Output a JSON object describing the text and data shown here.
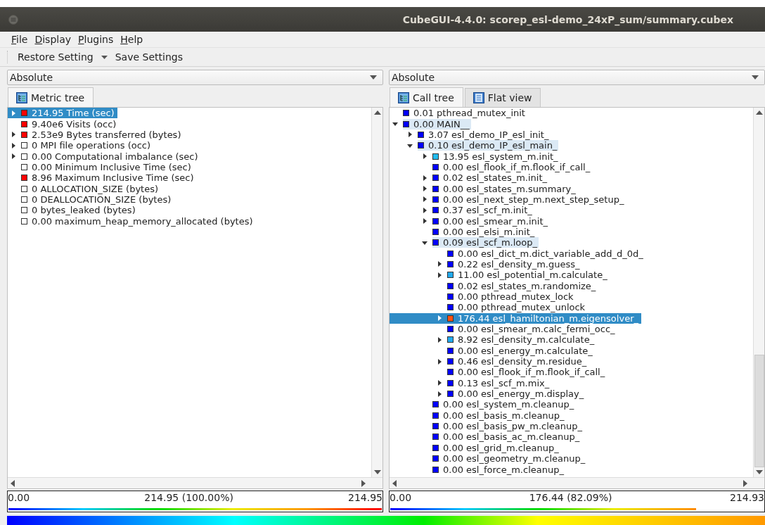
{
  "window": {
    "title": "CubeGUI-4.4.0: scorep_esl-demo_24xP_sum/summary.cubex"
  },
  "menu": [
    {
      "label": "File"
    },
    {
      "label": "Display"
    },
    {
      "label": "Plugins"
    },
    {
      "label": "Help"
    }
  ],
  "toolbar": {
    "restore": "Restore Setting",
    "save": "Save Settings"
  },
  "panes": [
    {
      "mode": "Absolute",
      "tabs": [
        {
          "label": "Metric tree",
          "kind": "tree",
          "selected": true
        }
      ],
      "tree": [
        {
          "label": "214.95 Time (sec)",
          "expandable": true,
          "expanded": false,
          "color": "#ff0000",
          "selected": true,
          "highlighted": false
        },
        {
          "label": "9.40e6 Visits (occ)",
          "expandable": false,
          "expanded": false,
          "color": "#ff0000",
          "selected": false,
          "highlighted": false
        },
        {
          "label": "2.53e9 Bytes transferred (bytes)",
          "expandable": true,
          "expanded": false,
          "color": "#ff0000",
          "selected": false,
          "highlighted": false
        },
        {
          "label": "0 MPI file operations (occ)",
          "expandable": true,
          "expanded": false,
          "color": "#ffffff",
          "selected": false,
          "highlighted": false
        },
        {
          "label": "0.00 Computational imbalance (sec)",
          "expandable": true,
          "expanded": false,
          "color": "#ffffff",
          "selected": false,
          "highlighted": false
        },
        {
          "label": "0.00 Minimum Inclusive Time (sec)",
          "expandable": false,
          "expanded": false,
          "color": "#ffffff",
          "selected": false,
          "highlighted": false
        },
        {
          "label": "8.96 Maximum Inclusive Time (sec)",
          "expandable": false,
          "expanded": false,
          "color": "#ff0000",
          "selected": false,
          "highlighted": false
        },
        {
          "label": "0 ALLOCATION_SIZE (bytes)",
          "expandable": false,
          "expanded": false,
          "color": "#ffffff",
          "selected": false,
          "highlighted": false
        },
        {
          "label": "0 DEALLOCATION_SIZE (bytes)",
          "expandable": false,
          "expanded": false,
          "color": "#ffffff",
          "selected": false,
          "highlighted": false
        },
        {
          "label": "0 bytes_leaked (bytes)",
          "expandable": false,
          "expanded": false,
          "color": "#ffffff",
          "selected": false,
          "highlighted": false
        },
        {
          "label": "0.00 maximum_heap_memory_allocated (bytes)",
          "expandable": false,
          "expanded": false,
          "color": "#ffffff",
          "selected": false,
          "highlighted": false
        }
      ],
      "value_bar": {
        "min": "0.00",
        "value": "214.95 (100.00%)",
        "max": "214.95",
        "level": 1
      }
    },
    {
      "mode": "Absolute",
      "tabs": [
        {
          "label": "Call tree",
          "kind": "tree",
          "selected": true
        },
        {
          "label": "Flat view",
          "kind": "flat",
          "selected": false
        }
      ],
      "tree": [
        {
          "label": "0.01 pthread_mutex_init",
          "expandable": false,
          "expanded": false,
          "color": "#0000ff",
          "selected": false,
          "highlighted": false
        },
        {
          "label": "0.00 MAIN__",
          "expandable": true,
          "expanded": true,
          "color": "#0000ff",
          "selected": false,
          "highlighted": true,
          "children": [
            {
              "label": "3.07 esl_demo_IP_esl_init_",
              "expandable": true,
              "expanded": false,
              "color": "#0000ff",
              "selected": false,
              "highlighted": false
            },
            {
              "label": "0.10 esl_demo_IP_esl_main_",
              "expandable": true,
              "expanded": true,
              "color": "#0000ff",
              "selected": false,
              "highlighted": true,
              "children": [
                {
                  "label": "13.95 esl_system_m.init_",
                  "expandable": true,
                  "expanded": false,
                  "color": "#22bbee",
                  "selected": false,
                  "highlighted": false
                },
                {
                  "label": "0.00 esl_flook_if_m.flook_if_call_",
                  "expandable": false,
                  "expanded": false,
                  "color": "#0000ff",
                  "selected": false,
                  "highlighted": false
                },
                {
                  "label": "0.02 esl_states_m.init_",
                  "expandable": true,
                  "expanded": false,
                  "color": "#0000ff",
                  "selected": false,
                  "highlighted": false
                },
                {
                  "label": "0.00 esl_states_m.summary_",
                  "expandable": true,
                  "expanded": false,
                  "color": "#0000ff",
                  "selected": false,
                  "highlighted": false
                },
                {
                  "label": "0.00 esl_next_step_m.next_step_setup_",
                  "expandable": true,
                  "expanded": false,
                  "color": "#0000ff",
                  "selected": false,
                  "highlighted": false
                },
                {
                  "label": "0.37 esl_scf_m.init_",
                  "expandable": true,
                  "expanded": false,
                  "color": "#0000ff",
                  "selected": false,
                  "highlighted": false
                },
                {
                  "label": "0.00 esl_smear_m.init_",
                  "expandable": true,
                  "expanded": false,
                  "color": "#0000ff",
                  "selected": false,
                  "highlighted": false
                },
                {
                  "label": "0.00 esl_elsi_m.init_",
                  "expandable": false,
                  "expanded": false,
                  "color": "#0000ff",
                  "selected": false,
                  "highlighted": false
                },
                {
                  "label": "0.09 esl_scf_m.loop_",
                  "expandable": true,
                  "expanded": true,
                  "color": "#0000ff",
                  "selected": false,
                  "highlighted": true,
                  "children": [
                    {
                      "label": "0.00 esl_dict_m.dict_variable_add_d_0d_",
                      "expandable": false,
                      "expanded": false,
                      "color": "#0000ff",
                      "selected": false,
                      "highlighted": false
                    },
                    {
                      "label": "0.22 esl_density_m.guess_",
                      "expandable": true,
                      "expanded": false,
                      "color": "#0000ff",
                      "selected": false,
                      "highlighted": false
                    },
                    {
                      "label": "11.00 esl_potential_m.calculate_",
                      "expandable": true,
                      "expanded": false,
                      "color": "#22aaee",
                      "selected": false,
                      "highlighted": false
                    },
                    {
                      "label": "0.02 esl_states_m.randomize_",
                      "expandable": false,
                      "expanded": false,
                      "color": "#0000ff",
                      "selected": false,
                      "highlighted": false
                    },
                    {
                      "label": "0.00 pthread_mutex_lock",
                      "expandable": false,
                      "expanded": false,
                      "color": "#0000ff",
                      "selected": false,
                      "highlighted": false
                    },
                    {
                      "label": "0.00 pthread_mutex_unlock",
                      "expandable": false,
                      "expanded": false,
                      "color": "#0000ff",
                      "selected": false,
                      "highlighted": false
                    },
                    {
                      "label": "176.44 esl_hamiltonian_m.eigensolver_",
                      "expandable": true,
                      "expanded": false,
                      "color": "#ff5010",
                      "selected": true,
                      "highlighted": false
                    },
                    {
                      "label": "0.00 esl_smear_m.calc_fermi_occ_",
                      "expandable": false,
                      "expanded": false,
                      "color": "#0000ff",
                      "selected": false,
                      "highlighted": false
                    },
                    {
                      "label": "8.92 esl_density_m.calculate_",
                      "expandable": true,
                      "expanded": false,
                      "color": "#22aaee",
                      "selected": false,
                      "highlighted": false
                    },
                    {
                      "label": "0.00 esl_energy_m.calculate_",
                      "expandable": false,
                      "expanded": false,
                      "color": "#0000ff",
                      "selected": false,
                      "highlighted": false
                    },
                    {
                      "label": "0.46 esl_density_m.residue_",
                      "expandable": true,
                      "expanded": false,
                      "color": "#0000ff",
                      "selected": false,
                      "highlighted": false
                    },
                    {
                      "label": "0.00 esl_flook_if_m.flook_if_call_",
                      "expandable": false,
                      "expanded": false,
                      "color": "#0000ff",
                      "selected": false,
                      "highlighted": false
                    },
                    {
                      "label": "0.13 esl_scf_m.mix_",
                      "expandable": true,
                      "expanded": false,
                      "color": "#0000ff",
                      "selected": false,
                      "highlighted": false
                    },
                    {
                      "label": "0.00 esl_energy_m.display_",
                      "expandable": true,
                      "expanded": false,
                      "color": "#0000ff",
                      "selected": false,
                      "highlighted": false
                    }
                  ]
                },
                {
                  "label": "0.00 esl_system_m.cleanup_",
                  "expandable": false,
                  "expanded": false,
                  "color": "#0000ff",
                  "selected": false,
                  "highlighted": false
                },
                {
                  "label": "0.00 esl_basis_m.cleanup_",
                  "expandable": false,
                  "expanded": false,
                  "color": "#0000ff",
                  "selected": false,
                  "highlighted": false
                },
                {
                  "label": "0.00 esl_basis_pw_m.cleanup_",
                  "expandable": false,
                  "expanded": false,
                  "color": "#0000ff",
                  "selected": false,
                  "highlighted": false
                },
                {
                  "label": "0.00 esl_basis_ac_m.cleanup_",
                  "expandable": false,
                  "expanded": false,
                  "color": "#0000ff",
                  "selected": false,
                  "highlighted": false
                },
                {
                  "label": "0.00 esl_grid_m.cleanup_",
                  "expandable": false,
                  "expanded": false,
                  "color": "#0000ff",
                  "selected": false,
                  "highlighted": false
                },
                {
                  "label": "0.00 esl_geometry_m.cleanup_",
                  "expandable": false,
                  "expanded": false,
                  "color": "#0000ff",
                  "selected": false,
                  "highlighted": false
                },
                {
                  "label": "0.00 esl_force_m.cleanup_",
                  "expandable": false,
                  "expanded": false,
                  "color": "#0000ff",
                  "selected": false,
                  "highlighted": false
                }
              ]
            }
          ]
        }
      ],
      "value_bar": {
        "min": "0.00",
        "value": "176.44 (82.09%)",
        "max": "214.93",
        "level": 0.82
      }
    }
  ]
}
